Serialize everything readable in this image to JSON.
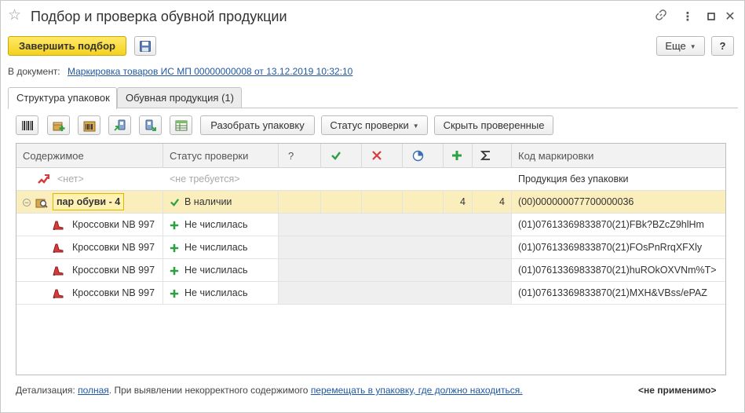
{
  "window": {
    "title": "Подбор и проверка обувной продукции",
    "more_glyph": "⋮"
  },
  "toolbar": {
    "finish_label": "Завершить подбор",
    "more_label": "Еще",
    "help_label": "?"
  },
  "document_line": {
    "prefix": "В документ:",
    "link": "Маркировка товаров ИС МП 00000000008 от 13.12.2019 10:32:10"
  },
  "tabs": [
    {
      "label": "Структура упаковок"
    },
    {
      "label": "Обувная продукция (1)"
    }
  ],
  "grid_toolbar": {
    "unpack_label": "Разобрать упаковку",
    "status_label": "Статус проверки",
    "hide_label": "Скрыть проверенные"
  },
  "columns": {
    "content": "Содержимое",
    "status": "Статус проверки",
    "question": "?",
    "code": "Код маркировки"
  },
  "rows": [
    {
      "content": "<нет>",
      "status": "<не требуется>",
      "code": "Продукция без упаковки"
    },
    {
      "content": "пар обуви - 4",
      "status": "В наличии",
      "plus": "4",
      "sum": "4",
      "code": "(00)000000077700000036"
    },
    {
      "content": "Кроссовки NB 997",
      "status": "Не числилась",
      "code": "(01)07613369833870(21)FBk?BZcZ9hlHm"
    },
    {
      "content": "Кроссовки NB 997",
      "status": "Не числилась",
      "code": "(01)07613369833870(21)FOsPnRrqXFXly"
    },
    {
      "content": "Кроссовки NB 997",
      "status": "Не числилась",
      "code": "(01)07613369833870(21)huROkOXVNm%T>"
    },
    {
      "content": "Кроссовки NB 997",
      "status": "Не числилась",
      "code": "(01)07613369833870(21)MXH&VBss/ePAZ"
    }
  ],
  "footer": {
    "prefix": "Детализация:",
    "detail_link": "полная",
    "middle": ". При выявлении некорректного содержимого",
    "action_link": "перемещать в упаковку, где должно находиться.",
    "right": "<не применимо>"
  },
  "colors": {
    "primary_button": "#f5d21e",
    "selected_row": "#fbeebd",
    "link": "#1f58a5",
    "check_green": "#2ea043",
    "cross_red": "#d83a3a"
  }
}
